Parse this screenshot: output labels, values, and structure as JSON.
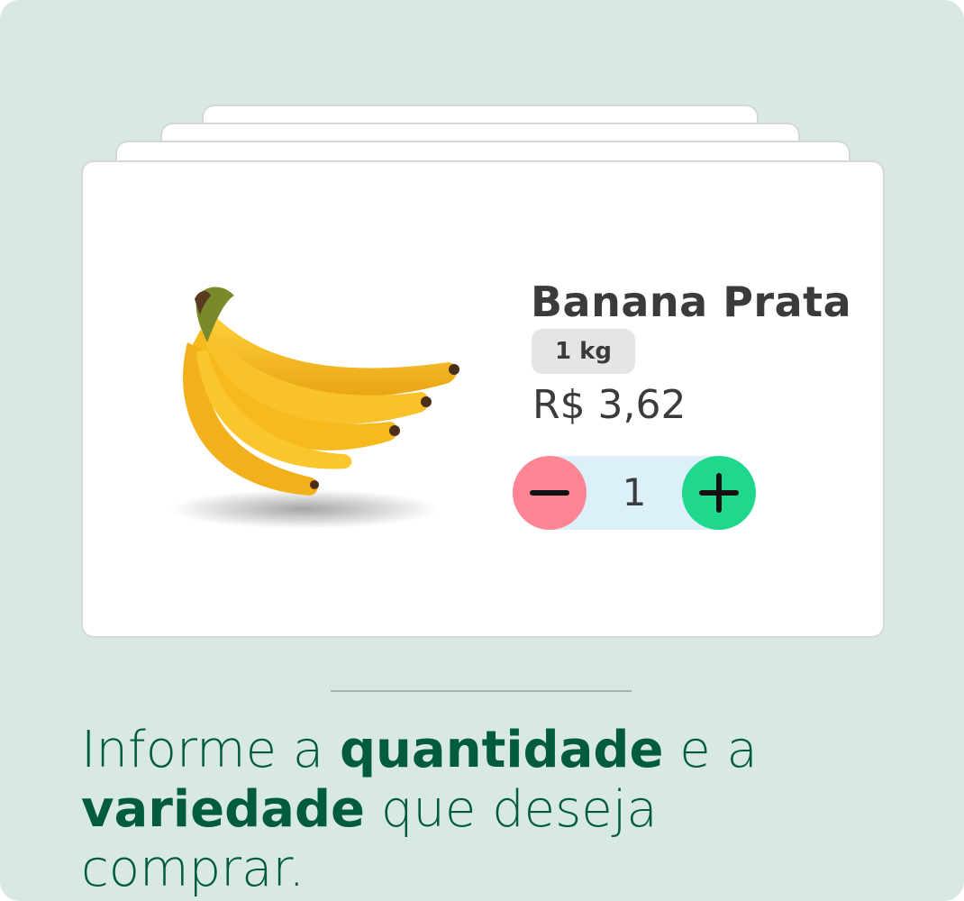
{
  "product": {
    "name": "Banana Prata",
    "weight": "1 kg",
    "price": "R$ 3,62",
    "quantity": "1"
  },
  "caption": {
    "part1": "Informe a ",
    "bold1": "quantidade",
    "part2": " e a",
    "bold2": "variedade",
    "part3": " que deseja comprar."
  },
  "icons": {
    "decrease": "minus-icon",
    "increase": "plus-icon"
  },
  "colors": {
    "background": "#d8e9e3",
    "minus_button": "#ff8594",
    "plus_button": "#1fd88e",
    "stepper_track": "#dcf0fa",
    "caption_text": "#005c3a"
  }
}
